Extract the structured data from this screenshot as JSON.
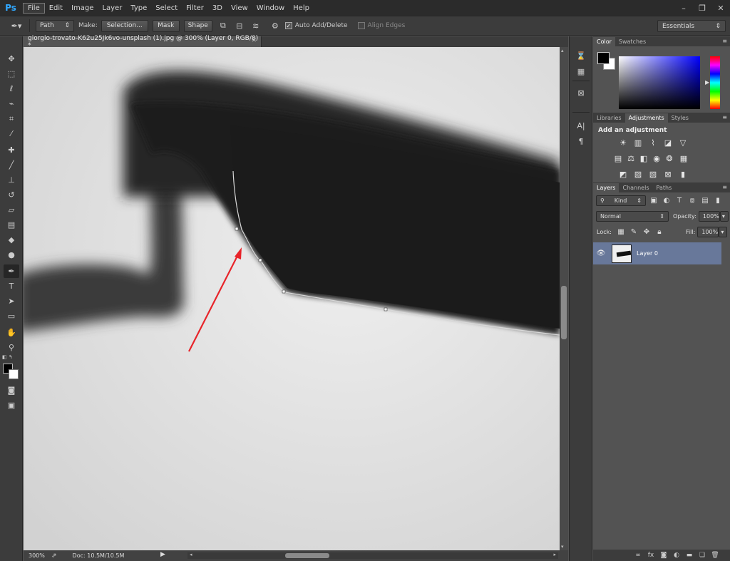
{
  "app": {
    "logo": "Ps"
  },
  "menu": [
    "File",
    "Edit",
    "Image",
    "Layer",
    "Type",
    "Select",
    "Filter",
    "3D",
    "View",
    "Window",
    "Help"
  ],
  "window_controls": [
    "–",
    "❐",
    "✕"
  ],
  "options": {
    "mode": "Path",
    "make_label": "Make:",
    "selection_btn": "Selection...",
    "mask_btn": "Mask",
    "shape_btn": "Shape",
    "auto_add_delete": "Auto Add/Delete",
    "align_edges": "Align Edges",
    "workspace": "Essentials"
  },
  "document": {
    "tab_title": "giorgio-trovato-K62u25Jk6vo-unsplash (1).jpg @ 300% (Layer 0, RGB/8) *",
    "zoom": "300%",
    "doc_size": "Doc: 10.5M/10.5M"
  },
  "colors": {
    "accent_logo": "#31a8ff",
    "selected_layer": "#68789a",
    "arrow": "#e8242a"
  },
  "color_panel": {
    "tabs": [
      "Color",
      "Swatches"
    ],
    "foreground": "#000000",
    "background": "#ffffff"
  },
  "adjustments_panel": {
    "tabs": [
      "Libraries",
      "Adjustments",
      "Styles"
    ],
    "title": "Add an adjustment"
  },
  "layers_panel": {
    "tabs": [
      "Layers",
      "Channels",
      "Paths"
    ],
    "filter": "Kind",
    "blend_mode": "Normal",
    "opacity_label": "Opacity:",
    "opacity": "100%",
    "lock_label": "Lock:",
    "fill_label": "Fill:",
    "fill": "100%",
    "layers": [
      {
        "name": "Layer 0",
        "visible": true
      }
    ]
  }
}
